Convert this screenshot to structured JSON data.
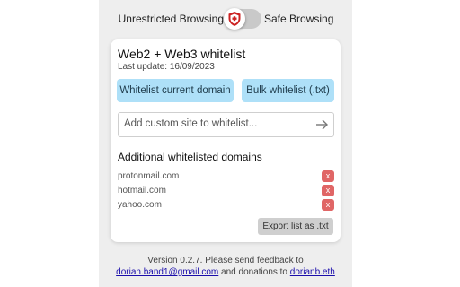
{
  "header": {
    "left_label": "Unrestricted Browsing",
    "right_label": "Safe Browsing",
    "toggle_state": "unrestricted"
  },
  "card": {
    "title": "Web2 + Web3 whitelist",
    "last_update": "Last update: 16/09/2023",
    "whitelist_domain_button": "Whitelist current domain",
    "bulk_button": "Bulk whitelist (.txt)",
    "add_placeholder": "Add custom site to whitelist...",
    "add_value": "",
    "section_title": "Additional whitelisted domains",
    "domains": [
      {
        "name": "protonmail.com",
        "remove": "x"
      },
      {
        "name": "hotmail.com",
        "remove": "x"
      },
      {
        "name": "yahoo.com",
        "remove": "x"
      }
    ],
    "export_button": "Export list as .txt"
  },
  "footer": {
    "line1": "Version 0.2.7. Please send feedback to",
    "email": "dorian.band1@gmail.com",
    "middle": " and donations to ",
    "eth": "dorianb.eth"
  },
  "colors": {
    "panel_bg": "#eeeeee",
    "blue_button": "#aee0f8",
    "remove_button": "#e06666",
    "shield_icon": "#cc2222"
  },
  "icons": {
    "toggle_knob": "shield-icon",
    "add_arrow": "arrow-right-icon"
  }
}
